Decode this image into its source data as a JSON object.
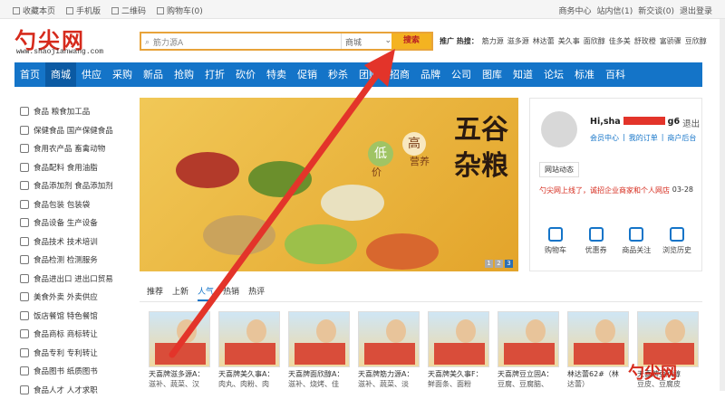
{
  "topbar": {
    "left": [
      {
        "icon": "star-icon",
        "label": "收藏本页"
      },
      {
        "icon": "mobile-icon",
        "label": "手机版"
      },
      {
        "icon": "qrcode-icon",
        "label": "二维码"
      },
      {
        "icon": "cart-icon",
        "label": "购物车(0)"
      }
    ],
    "right": [
      "商务中心",
      "站内信(1)",
      "新交谈(0)",
      "退出登录"
    ]
  },
  "header": {
    "logo": "勺尖网",
    "logo_url": "www.shaojianwang.com",
    "search_value": "筋力源A",
    "search_category": "商城",
    "search_button": "搜索",
    "hot_label": "推广 热搜：",
    "hot_terms": [
      "筋力源",
      "滋多源",
      "林达蕾",
      "美久事",
      "面欣醇",
      "佳多美",
      "舒玫橙",
      "富骄骤",
      "豆欣醇"
    ]
  },
  "nav": [
    "首页",
    "商城",
    "供应",
    "采购",
    "新品",
    "抢购",
    "打折",
    "砍价",
    "特卖",
    "促销",
    "秒杀",
    "团购",
    "招商",
    "品牌",
    "公司",
    "图库",
    "知道",
    "论坛",
    "标准",
    "百科"
  ],
  "sidebar": [
    "食品 粮食加工品",
    "保健食品 国产保健食品",
    "食用农产品 畜禽动物",
    "食品配料 食用油脂",
    "食品添加剂 食品添加剂",
    "食品包装 包装袋",
    "食品设备 生产设备",
    "食品技术 技术培训",
    "食品检测 检测服务",
    "食品进出口 进出口贸易",
    "美食外卖 外卖供应",
    "饭店餐馆 特色餐馆",
    "食品商标 商标转让",
    "食品专利 专利转让",
    "食品图书 纸质图书",
    "食品人才 人才求职"
  ],
  "banner": {
    "title": "五谷杂粮",
    "tag1": "高",
    "tag2": "低",
    "tag3": "价",
    "tag4": "营养",
    "pages": [
      "1",
      "2",
      "3"
    ]
  },
  "user": {
    "hi": "Hi,sha",
    "suffix": "g6",
    "logout": "退出",
    "links": [
      "会员中心",
      "我的订单",
      "商户后台"
    ],
    "tab": "网站动态",
    "news_title": "勺尖网上线了，诚招企业商家和个人网店",
    "news_date": "03-28",
    "quick": [
      "购物车",
      "优惠券",
      "商品关注",
      "浏览历史"
    ]
  },
  "product_tabs": [
    "推荐",
    "上新",
    "人气",
    "热销",
    "热评"
  ],
  "products": [
    {
      "name": "天喜牌滋多源A：",
      "sub": "滋补、蔬菜、汉"
    },
    {
      "name": "天喜牌美久事A：",
      "sub": "肉丸、肉粉、肉"
    },
    {
      "name": "天喜牌面欣醇A：",
      "sub": "滋补、烧烤、佳"
    },
    {
      "name": "天喜牌筋力源A：",
      "sub": "滋补、蔬菜、淡"
    },
    {
      "name": "天喜牌美久事F：",
      "sub": "鲜面条、面粉"
    },
    {
      "name": "天喜牌豆立固A：",
      "sub": "豆腐、豆腐脑、"
    },
    {
      "name": "林达蕾62#（林",
      "sub": "达蕾）"
    },
    {
      "name": "天喜牌豆欣醇",
      "sub": "豆皮、豆腐皮"
    }
  ],
  "watermark": "勺尖网",
  "colors": {
    "brand_blue": "#1474c8",
    "brand_red": "#d62a1c",
    "search_orange": "#f4b321"
  }
}
